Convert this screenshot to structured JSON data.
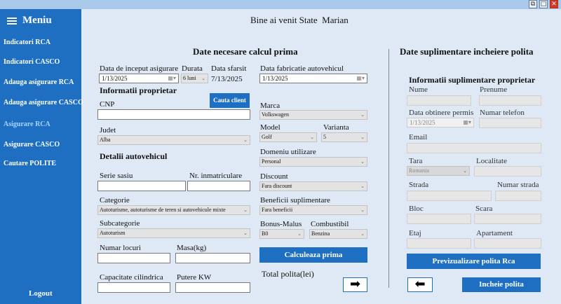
{
  "window": {
    "icons": [
      "restore-icon",
      "maximize-icon",
      "close-icon"
    ]
  },
  "sidebar": {
    "title": "Meniu",
    "items": [
      {
        "label": "Indicatori RCA"
      },
      {
        "label": "Indicatori CASCO"
      },
      {
        "label": "Adauga asigurare RCA"
      },
      {
        "label": "Adauga asigurare CASCO"
      },
      {
        "label": "Asigurare RCA"
      },
      {
        "label": "Asigurare CASCO"
      },
      {
        "label": "Cautare POLITE"
      }
    ],
    "logout": "Logout",
    "colors": {
      "background": "#1e6fc2",
      "active": "#a8d4ff"
    }
  },
  "header": {
    "welcome": "Bine ai venit State  Marian"
  },
  "calc": {
    "title": "Date necesare calcul prima",
    "start_date_label": "Data de inceput asigurare",
    "start_date_value": "1/13/2025",
    "duration_label": "Durata",
    "duration_value": "6 luni",
    "end_date_label": "Data sfarsit",
    "end_date_value": "7/13/2025",
    "owner_title": "Informatii proprietar",
    "cnp_label": "CNP",
    "search_client": "Cauta client",
    "judet_label": "Judet",
    "judet_value": "Alba",
    "vehicle_title": "Detalii autovehicul",
    "vin_label": "Serie sasiu",
    "reg_label": "Nr. inmatriculare",
    "category_label": "Categorie",
    "category_value": "Autoturisme, autoturisme de teren si autovehicule mixte",
    "subcategory_label": "Subcategorie",
    "subcategory_value": "Autoturism",
    "seats_label": "Numar locuri",
    "mass_label": "Masa(kg)",
    "capacity_label": "Capacitate cilindrica",
    "power_label": "Putere KW",
    "manufacture_label": "Data fabricatie autovehicul",
    "manufacture_value": "1/13/2025",
    "brand_label": "Marca",
    "brand_value": "Volkswagen",
    "model_label": "Model",
    "model_value": "Golf",
    "variant_label": "Varianta",
    "variant_value": "5",
    "usage_label": "Domeniu utilizare",
    "usage_value": "Personal",
    "discount_label": "Discount",
    "discount_value": "Fara discount",
    "benefits_label": "Beneficii suplimentare",
    "benefits_value": "Fara beneficii",
    "bonus_label": "Bonus-Malus",
    "bonus_value": "B0",
    "fuel_label": "Combustibil",
    "fuel_value": "Benzina",
    "calculate": "Calculeaza prima",
    "total_label": "Total polita(lei)",
    "next_arrow": "➡"
  },
  "extra": {
    "title": "Date suplimentare incheiere polita",
    "subtitle": "Informatii suplimentare proprietar",
    "name_label": "Nume",
    "surname_label": "Prenume",
    "license_label": "Data obtinere permis",
    "license_value": "1/13/2025",
    "phone_label": "Numar telefon",
    "email_label": "Email",
    "country_label": "Tara",
    "country_value": "Romania",
    "city_label": "Localitate",
    "street_label": "Strada",
    "street_no_label": "Numar strada",
    "block_label": "Bloc",
    "stair_label": "Scara",
    "floor_label": "Etaj",
    "apartment_label": "Apartament",
    "preview": "Previzualizare polita Rca",
    "back_arrow": "⬅",
    "finish": "Incheie polita"
  }
}
